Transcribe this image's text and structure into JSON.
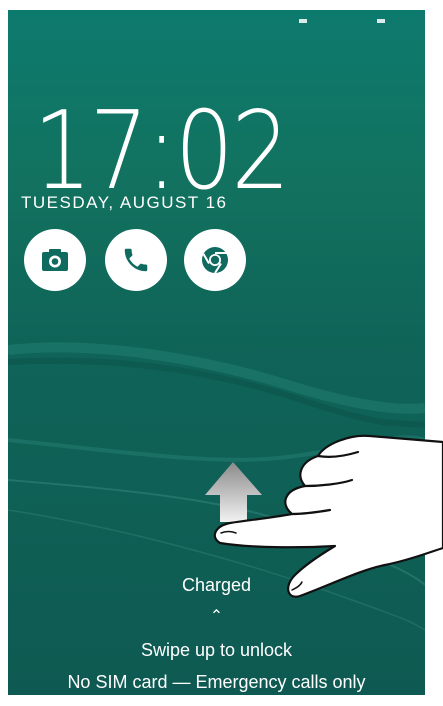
{
  "lockscreen": {
    "time": "17:02",
    "date": "TUESDAY, AUGUST 16",
    "charging_status": "Charged",
    "swipe_chevron": "⌃",
    "swipe_hint": "Swipe up to unlock",
    "carrier_status": "No SIM card — Emergency calls only"
  },
  "shortcuts": [
    {
      "icon": "camera-icon"
    },
    {
      "icon": "phone-icon"
    },
    {
      "icon": "chrome-icon"
    }
  ],
  "colors": {
    "wallpaper_top": "#0d7a6e",
    "wallpaper_bottom": "#0e5a52",
    "icon_circle": "#ffffff",
    "icon_glyph": "#0f6a60"
  }
}
